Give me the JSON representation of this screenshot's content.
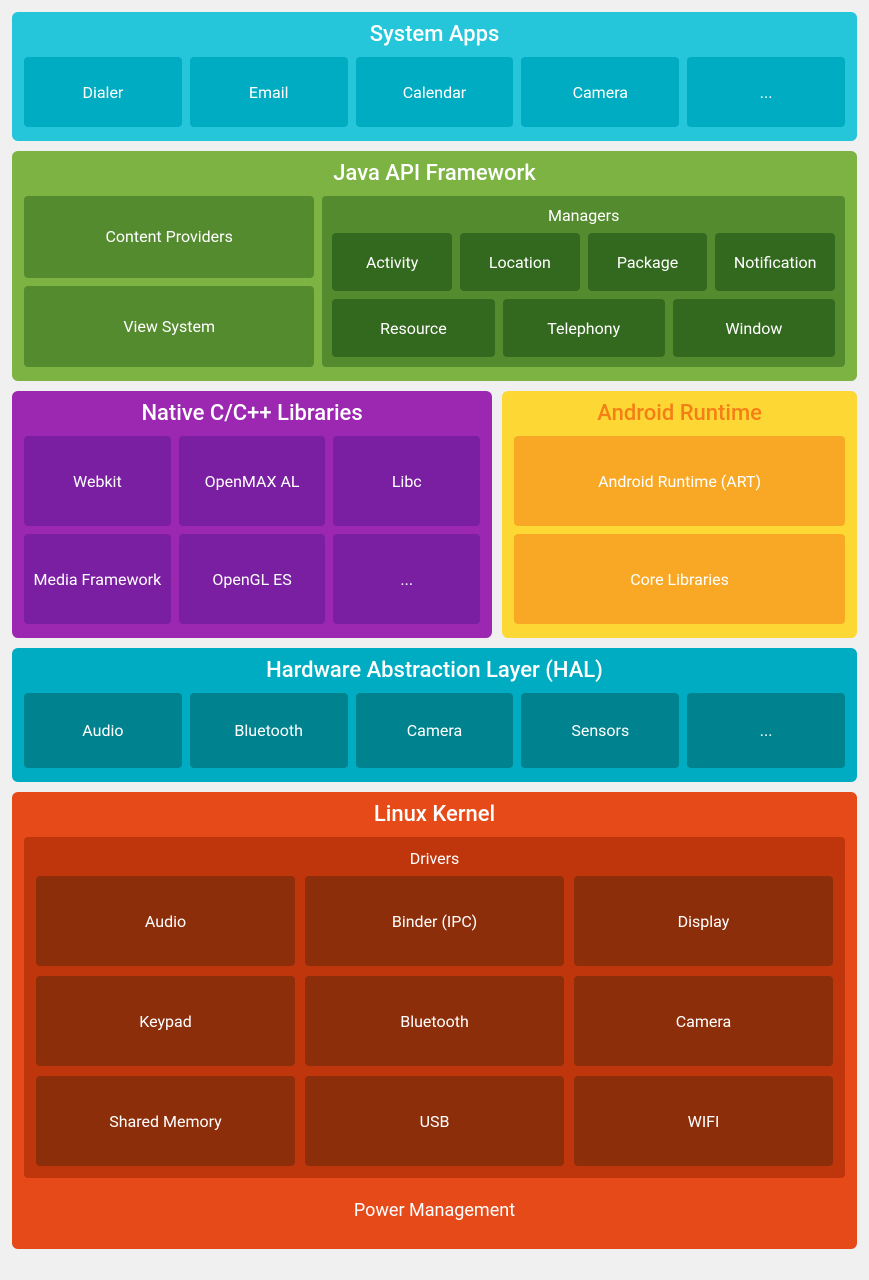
{
  "system_apps": {
    "title": "System Apps",
    "items": [
      "Dialer",
      "Email",
      "Calendar",
      "Camera",
      "..."
    ]
  },
  "java_api": {
    "title": "Java API Framework",
    "left_items": [
      "Content Providers",
      "View System"
    ],
    "managers_title": "Managers",
    "managers_row1": [
      "Activity",
      "Location",
      "Package",
      "Notification"
    ],
    "managers_row2": [
      "Resource",
      "Telephony",
      "Window"
    ]
  },
  "native_libs": {
    "title": "Native C/C++ Libraries",
    "items": [
      "Webkit",
      "OpenMAX AL",
      "Libc",
      "Media Framework",
      "OpenGL ES",
      "..."
    ]
  },
  "android_runtime": {
    "title": "Android Runtime",
    "items": [
      "Android Runtime (ART)",
      "Core Libraries"
    ]
  },
  "hal": {
    "title": "Hardware Abstraction Layer (HAL)",
    "items": [
      "Audio",
      "Bluetooth",
      "Camera",
      "Sensors",
      "..."
    ]
  },
  "linux_kernel": {
    "title": "Linux Kernel",
    "drivers_title": "Drivers",
    "drivers": [
      "Audio",
      "Binder (IPC)",
      "Display",
      "Keypad",
      "Bluetooth",
      "Camera",
      "Shared Memory",
      "USB",
      "WIFI"
    ],
    "power_management": "Power Management"
  }
}
